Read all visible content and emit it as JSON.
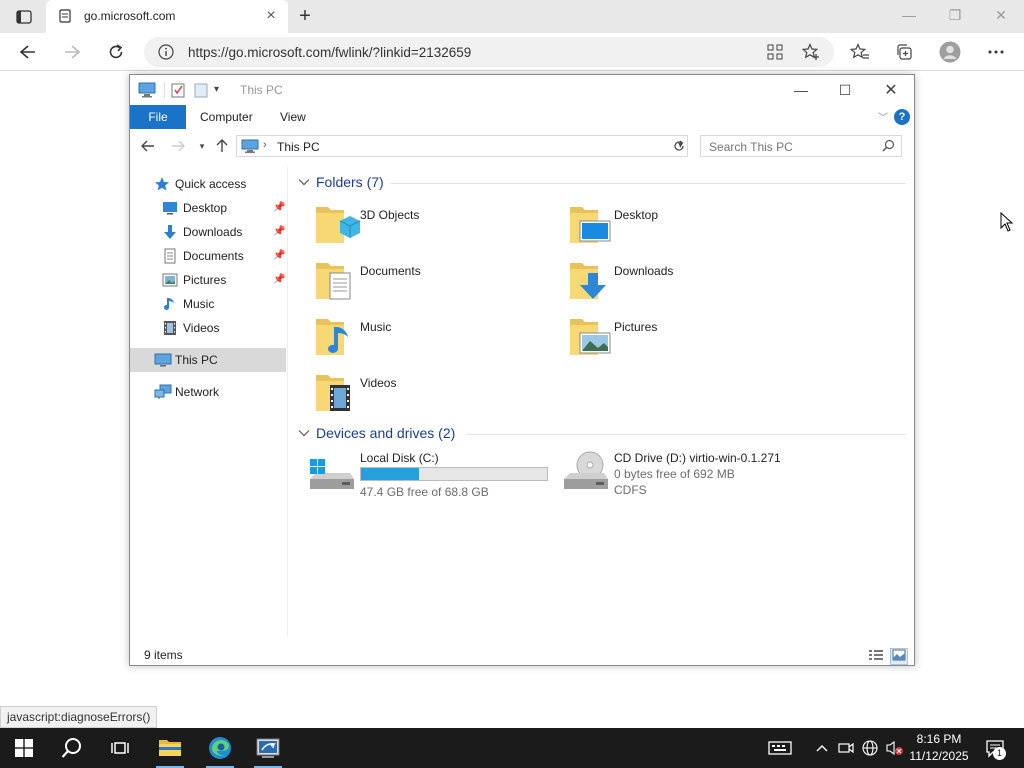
{
  "browser": {
    "tab_title": "go.microsoft.com",
    "url": "https://go.microsoft.com/fwlink/?linkid=2132659",
    "status_bar_text": "javascript:diagnoseErrors()"
  },
  "explorer": {
    "window_title": "This PC",
    "ribbon_tabs": [
      "File",
      "Computer",
      "View"
    ],
    "help_label": "?",
    "address_path": "This PC",
    "search_placeholder": "Search This PC",
    "sidebar": [
      {
        "label": "Quick access",
        "icon": "star-icon",
        "pinned": false
      },
      {
        "label": "Desktop",
        "icon": "desktop-icon",
        "pinned": true
      },
      {
        "label": "Downloads",
        "icon": "download-icon",
        "pinned": true
      },
      {
        "label": "Documents",
        "icon": "document-icon",
        "pinned": true
      },
      {
        "label": "Pictures",
        "icon": "picture-icon",
        "pinned": true
      },
      {
        "label": "Music",
        "icon": "music-icon",
        "pinned": false
      },
      {
        "label": "Videos",
        "icon": "video-icon",
        "pinned": false
      },
      {
        "label": "This PC",
        "icon": "computer-icon",
        "pinned": false,
        "selected": true
      },
      {
        "label": "Network",
        "icon": "network-icon",
        "pinned": false
      }
    ],
    "folders_group": "Folders (7)",
    "folders": [
      {
        "label": "3D Objects",
        "icon": "3d-objects-folder-icon"
      },
      {
        "label": "Desktop",
        "icon": "desktop-folder-icon"
      },
      {
        "label": "Documents",
        "icon": "documents-folder-icon"
      },
      {
        "label": "Downloads",
        "icon": "downloads-folder-icon"
      },
      {
        "label": "Music",
        "icon": "music-folder-icon"
      },
      {
        "label": "Pictures",
        "icon": "pictures-folder-icon"
      },
      {
        "label": "Videos",
        "icon": "videos-folder-icon"
      }
    ],
    "drives_group": "Devices and drives (2)",
    "drives": [
      {
        "name": "Local Disk (C:)",
        "free_text": "47.4 GB free of 68.8 GB",
        "used_fraction": 0.31,
        "icon": "hard-drive-icon"
      },
      {
        "name": "CD Drive (D:) virtio-win-0.1.271",
        "free_text": "0 bytes free of 692 MB",
        "fs_text": "CDFS",
        "icon": "cd-drive-icon"
      }
    ],
    "status_items": "9 items"
  },
  "taskbar": {
    "time": "8:16 PM",
    "date": "11/12/2025",
    "notification_count": "1"
  },
  "colors": {
    "accent": "#1a73c6",
    "drive_fill": "#26a0da",
    "group_title": "#1e3d8f",
    "taskbar": "#1b1b1b"
  }
}
